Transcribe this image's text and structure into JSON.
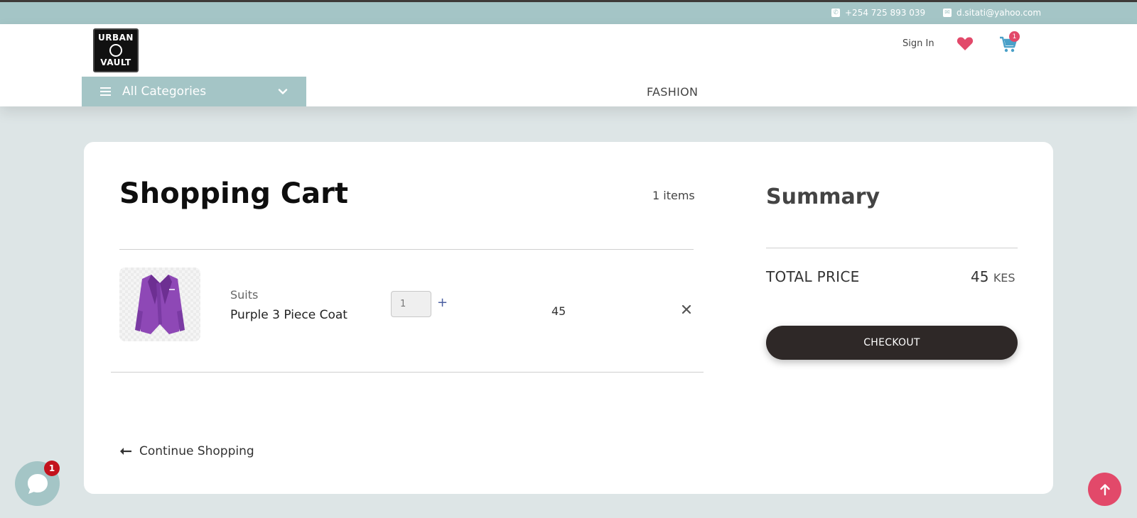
{
  "topbar": {
    "phone": "+254 725 893 039",
    "email": "d.sitati@yahoo.com",
    "phone_icon": "phone-icon",
    "email_icon": "mail-icon"
  },
  "header": {
    "logo_line1": "URBAN",
    "logo_line2": "VAULT",
    "signin_label": "Sign In",
    "cart_count": "1",
    "categories_label": "All Categories",
    "nav_fashion": "FASHION"
  },
  "cart": {
    "title": "Shopping Cart",
    "items_count": "1 items",
    "items": [
      {
        "category": "Suits",
        "name": "Purple 3 Piece Coat",
        "quantity": "1",
        "price": "45"
      }
    ],
    "continue_label": "Continue Shopping"
  },
  "summary": {
    "title": "Summary",
    "total_label": "TOTAL PRICE",
    "total_value": "45",
    "currency": "KES",
    "checkout_label": "CHECKOUT"
  },
  "chat": {
    "badge": "1"
  },
  "colors": {
    "accent": "#a4c5c6",
    "brand_pink": "#e2496a",
    "checkout": "#2e2827",
    "background": "#dde5e6"
  }
}
